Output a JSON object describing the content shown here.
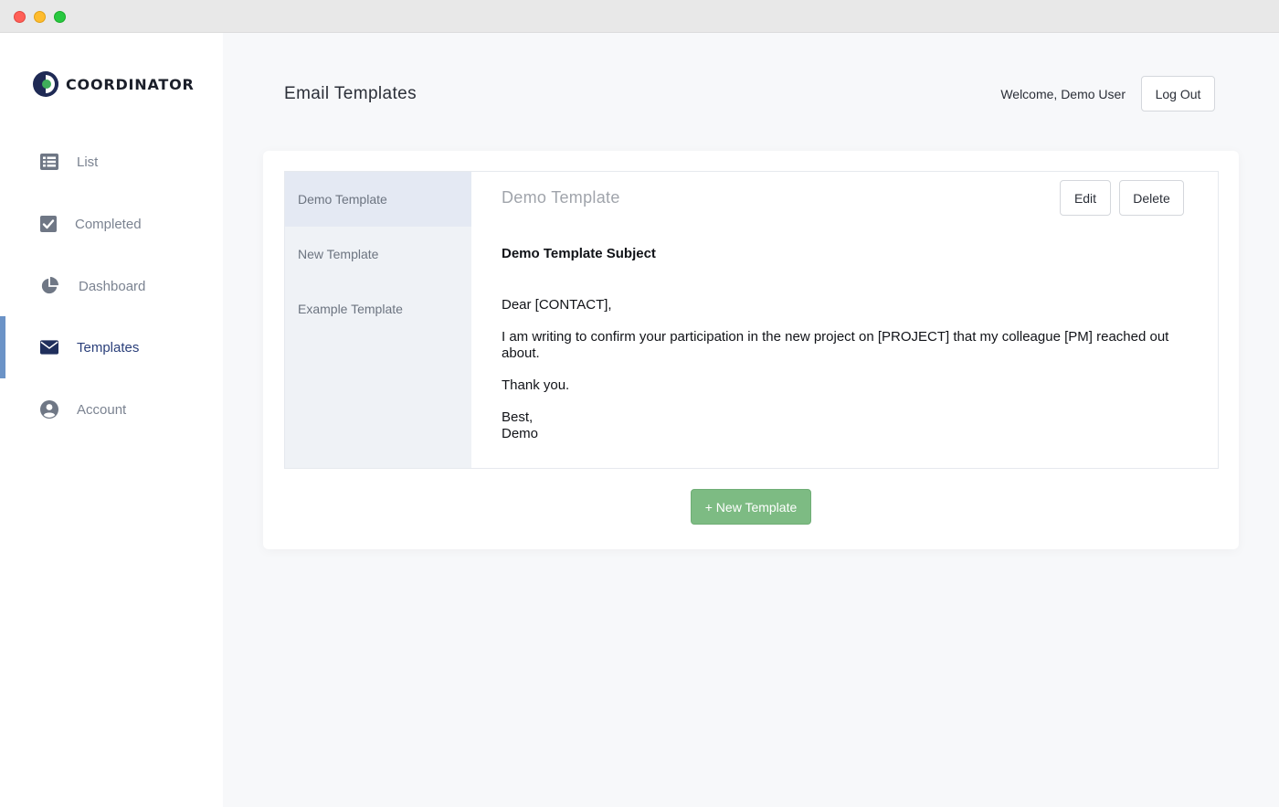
{
  "window": {
    "controls": [
      "close",
      "minimize",
      "maximize"
    ]
  },
  "brand": {
    "name": "COORDINATOR"
  },
  "sidebar": {
    "items": [
      {
        "label": "List",
        "icon": "list-icon"
      },
      {
        "label": "Completed",
        "icon": "checkbox-icon"
      },
      {
        "label": "Dashboard",
        "icon": "pie-chart-icon"
      },
      {
        "label": "Templates",
        "icon": "envelope-icon",
        "active": true
      },
      {
        "label": "Account",
        "icon": "user-circle-icon"
      }
    ]
  },
  "header": {
    "title": "Email Templates",
    "welcome": "Welcome, Demo User",
    "logout_label": "Log Out"
  },
  "templates": {
    "list": [
      "Demo Template",
      "New Template",
      "Example Template"
    ],
    "selected_index": 0,
    "detail": {
      "title": "Demo Template",
      "edit_label": "Edit",
      "delete_label": "Delete",
      "subject": "Demo Template Subject",
      "greeting": "Dear [CONTACT],",
      "paragraph": "I am writing to confirm your participation in the new project on [PROJECT] that my colleague [PM] reached out about.",
      "thanks": "Thank you.",
      "signoff": "Best,",
      "signature": "Demo"
    },
    "new_button_label": "+ New Template"
  },
  "colors": {
    "active_nav": "#2a3f7a",
    "active_indicator": "#6b93c7",
    "new_button": "#7dbb83",
    "logo_navy": "#1f2a55",
    "logo_green": "#3fae5a"
  }
}
